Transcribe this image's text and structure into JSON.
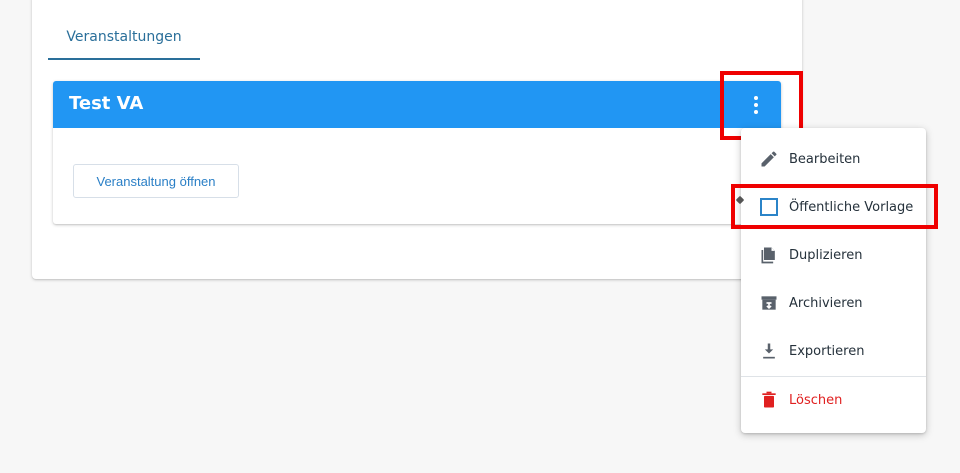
{
  "tabs": [
    {
      "label": "Veranstaltungen",
      "active": true
    }
  ],
  "event": {
    "title": "Test VA",
    "open_button": "Veranstaltung öffnen"
  },
  "menu": {
    "items": [
      {
        "label": "Bearbeiten",
        "icon": "pencil-icon"
      },
      {
        "label": "Öffentliche Vorlage",
        "icon": "checkbox-outline-icon",
        "checked": false
      },
      {
        "label": "Duplizieren",
        "icon": "copy-icon"
      },
      {
        "label": "Archivieren",
        "icon": "archive-icon"
      },
      {
        "label": "Exportieren",
        "icon": "download-icon"
      },
      {
        "label": "Löschen",
        "icon": "trash-icon",
        "danger": true
      }
    ]
  },
  "colors": {
    "header": "#2196f3",
    "tab_accent": "#2a6f9a",
    "delete": "#e02020",
    "highlight": "#ef0000"
  }
}
